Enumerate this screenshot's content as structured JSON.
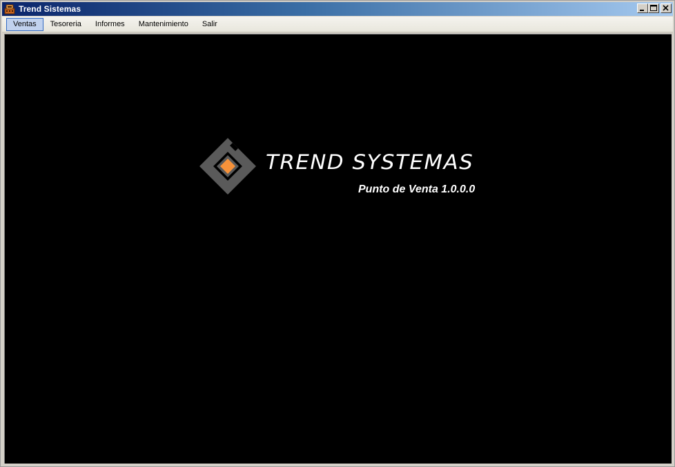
{
  "window": {
    "title": "Trend Sistemas",
    "icon": "app-register-icon",
    "buttons": {
      "minimize_icon": "minimize-icon",
      "maximize_icon": "maximize-icon",
      "close_icon": "close-icon"
    }
  },
  "menu": {
    "items": [
      {
        "label": "Ventas",
        "active": true
      },
      {
        "label": "Tesoreria",
        "active": false
      },
      {
        "label": "Informes",
        "active": false
      },
      {
        "label": "Mantenimiento",
        "active": false
      },
      {
        "label": "Salir",
        "active": false
      }
    ]
  },
  "splash": {
    "brand": "TREND SYSTEMAS",
    "subtitle": "Punto de Venta 1.0.0.0",
    "logo": "trend-diamond-logo",
    "colors": {
      "background": "#000000",
      "logo_gray": "#5a5a5a",
      "logo_orange": "#f7923a",
      "text": "#ffffff"
    }
  }
}
